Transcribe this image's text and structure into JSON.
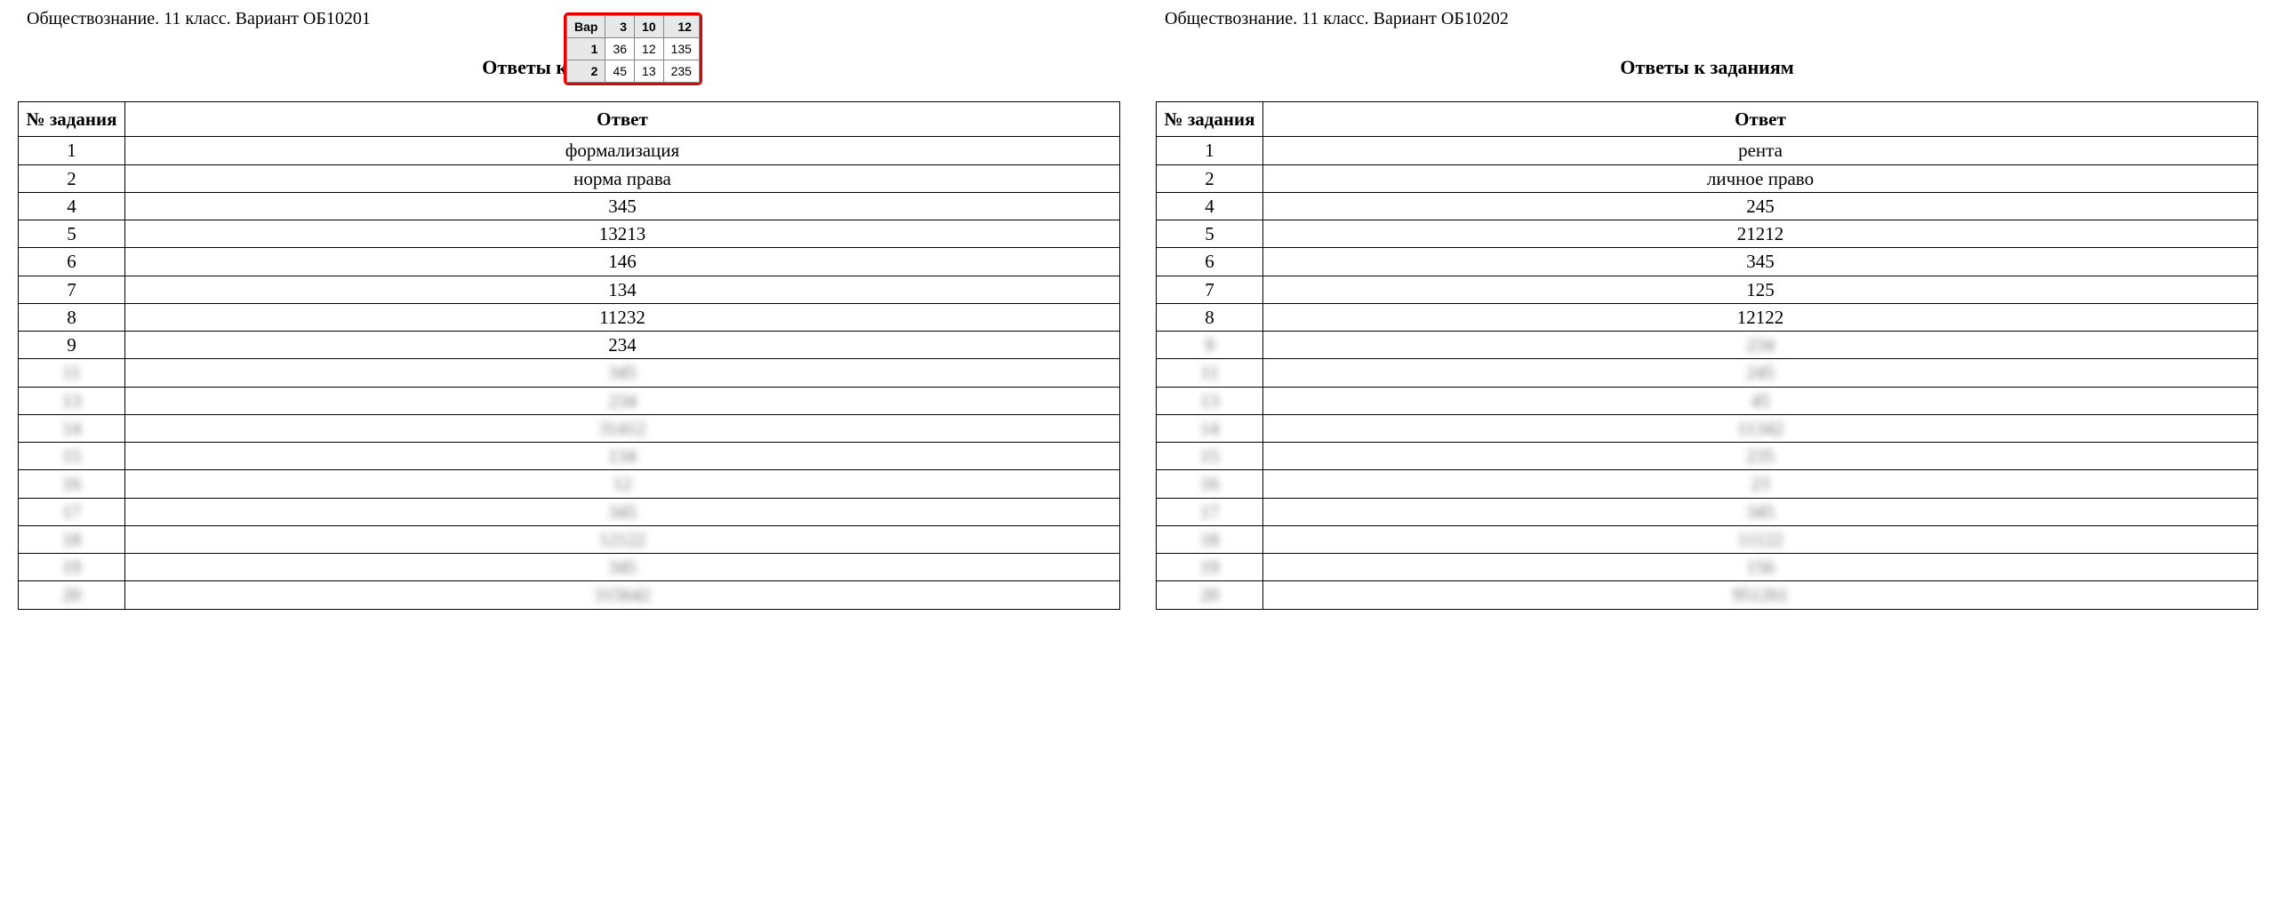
{
  "score_box": {
    "header": [
      "Вар",
      "3",
      "10",
      "12"
    ],
    "rows": [
      [
        "1",
        "36",
        "12",
        "135"
      ],
      [
        "2",
        "45",
        "13",
        "235"
      ]
    ]
  },
  "pages": [
    {
      "title": "Обществознание. 11 класс. Вариант ОБ10201",
      "heading": "Ответы к заданиям",
      "columns": {
        "num": "№ задания",
        "ans": "Ответ"
      },
      "rows": [
        {
          "num": "1",
          "ans": "формализация"
        },
        {
          "num": "2",
          "ans": "норма права"
        },
        {
          "num": "4",
          "ans": "345"
        },
        {
          "num": "5",
          "ans": "13213"
        },
        {
          "num": "6",
          "ans": "146"
        },
        {
          "num": "7",
          "ans": "134"
        },
        {
          "num": "8",
          "ans": "11232"
        },
        {
          "num": "9",
          "ans": "234"
        }
      ],
      "blurred_rows": [
        {
          "num": "11",
          "ans": "345"
        },
        {
          "num": "13",
          "ans": "234"
        },
        {
          "num": "14",
          "ans": "31412"
        },
        {
          "num": "15",
          "ans": "134"
        },
        {
          "num": "16",
          "ans": "12"
        },
        {
          "num": "17",
          "ans": "345"
        },
        {
          "num": "18",
          "ans": "12122"
        },
        {
          "num": "19",
          "ans": "345"
        },
        {
          "num": "20",
          "ans": "315642"
        }
      ]
    },
    {
      "title": "Обществознание. 11 класс. Вариант ОБ10202",
      "heading": "Ответы к заданиям",
      "columns": {
        "num": "№ задания",
        "ans": "Ответ"
      },
      "rows": [
        {
          "num": "1",
          "ans": "рента"
        },
        {
          "num": "2",
          "ans": "личное право"
        },
        {
          "num": "4",
          "ans": "245"
        },
        {
          "num": "5",
          "ans": "21212"
        },
        {
          "num": "6",
          "ans": "345"
        },
        {
          "num": "7",
          "ans": "125"
        },
        {
          "num": "8",
          "ans": "12122"
        }
      ],
      "blurred_rows": [
        {
          "num": "9",
          "ans": "234"
        },
        {
          "num": "11",
          "ans": "245"
        },
        {
          "num": "13",
          "ans": "45"
        },
        {
          "num": "14",
          "ans": "11342"
        },
        {
          "num": "15",
          "ans": "235"
        },
        {
          "num": "16",
          "ans": "23"
        },
        {
          "num": "17",
          "ans": "345"
        },
        {
          "num": "18",
          "ans": "11122"
        },
        {
          "num": "19",
          "ans": "156"
        },
        {
          "num": "20",
          "ans": "951261"
        }
      ]
    }
  ]
}
